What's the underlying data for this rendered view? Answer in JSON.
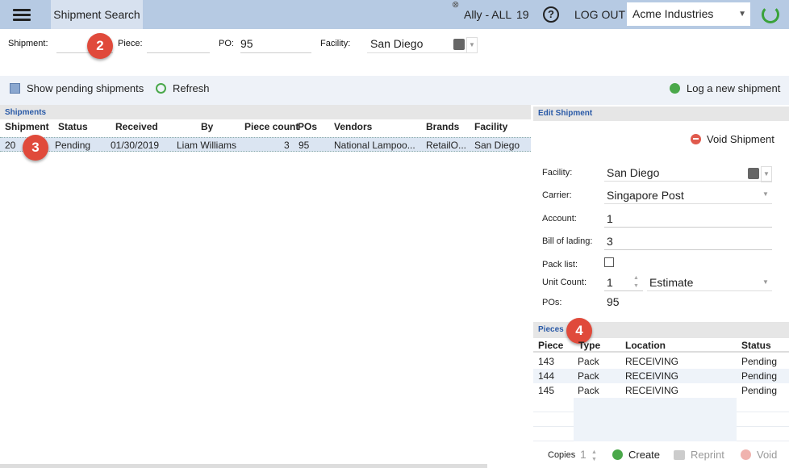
{
  "header": {
    "tab_title": "Shipment Search",
    "user": "Ally - ALL",
    "count": "19",
    "help": "?",
    "logout": "LOG OUT",
    "company": "Acme Industries",
    "close": "⊗"
  },
  "filters": {
    "shipment_label": "Shipment:",
    "piece_label": "Piece:",
    "po_label": "PO:",
    "po_value": "95",
    "facility_label": "Facility:",
    "facility_value": "San Diego"
  },
  "badges": {
    "b2": "2",
    "b3": "3",
    "b4": "4"
  },
  "actions": {
    "pending": "Show pending shipments",
    "refresh": "Refresh",
    "log_new": "Log a new shipment"
  },
  "shipments": {
    "title": "Shipments",
    "columns": [
      "Shipment",
      "Status",
      "Received",
      "By",
      "Piece count",
      "POs",
      "Vendors",
      "Brands",
      "Facility"
    ],
    "row": {
      "shipment": "20",
      "status": "Pending",
      "received": "01/30/2019",
      "by": "Liam Williams",
      "piece_count": "3",
      "pos": "95",
      "vendors": "National Lampoo...",
      "brands": "RetailO...",
      "facility": "San Diego"
    }
  },
  "edit": {
    "title": "Edit Shipment",
    "void": "Void Shipment",
    "facility_label": "Facility:",
    "facility": "San Diego",
    "carrier_label": "Carrier:",
    "carrier": "Singapore Post",
    "account_label": "Account:",
    "account": "1",
    "bol_label": "Bill of lading:",
    "bol": "3",
    "packlist_label": "Pack list:",
    "unitcount_label": "Unit Count:",
    "unitcount": "1",
    "unittype": "Estimate",
    "pos_label": "POs:",
    "pos": "95"
  },
  "pieces": {
    "title": "Pieces",
    "columns": [
      "Piece",
      "Type",
      "Location",
      "Status"
    ],
    "rows": [
      {
        "piece": "143",
        "type": "Pack",
        "location": "RECEIVING",
        "status": "Pending"
      },
      {
        "piece": "144",
        "type": "Pack",
        "location": "RECEIVING",
        "status": "Pending"
      },
      {
        "piece": "145",
        "type": "Pack",
        "location": "RECEIVING",
        "status": "Pending"
      }
    ]
  },
  "footer": {
    "copies_label": "Copies",
    "copies": "1",
    "create": "Create",
    "reprint": "Reprint",
    "void": "Void"
  }
}
